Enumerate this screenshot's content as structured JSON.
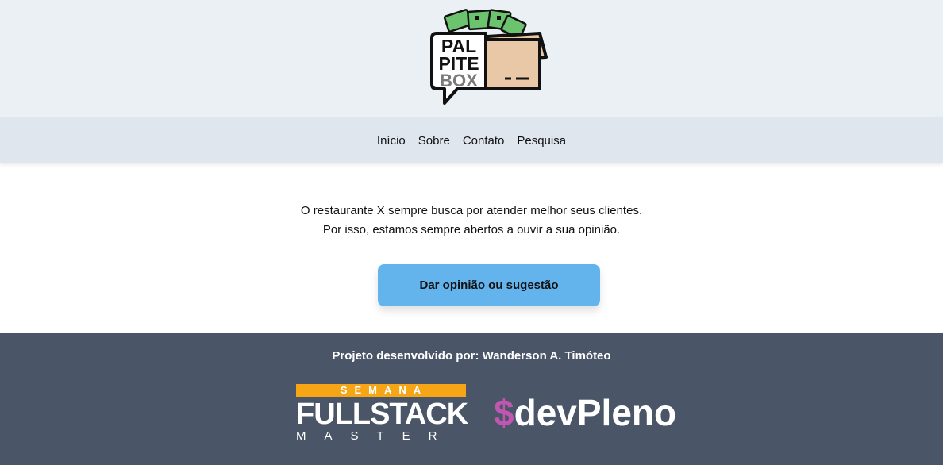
{
  "header": {
    "logo": {
      "line1": "PAL",
      "line2": "PITE",
      "line3": "BOX"
    }
  },
  "nav": {
    "items": [
      "Início",
      "Sobre",
      "Contato",
      "Pesquisa"
    ]
  },
  "main": {
    "line1": "O restaurante X sempre busca por atender melhor seus clientes.",
    "line2": "Por isso, estamos sempre abertos a ouvir a sua opinião.",
    "cta_label": "Dar opinião ou sugestão"
  },
  "footer": {
    "credit": "Projeto desenvolvido por: Wanderson A. Timóteo",
    "fullstack_logo": {
      "top": "SEMANA",
      "middle": "FULLSTACK",
      "bottom": "MASTER"
    },
    "devpleno_logo": {
      "symbol": "$",
      "word": "devPleno"
    }
  },
  "colors": {
    "header_bg": "#ebf0f5",
    "nav_bg": "#e0e6ee",
    "cta_bg": "#63b3ed",
    "footer_bg": "#4a5568",
    "semana_orange": "#f6a515",
    "devpleno_pink": "#c056b0"
  }
}
